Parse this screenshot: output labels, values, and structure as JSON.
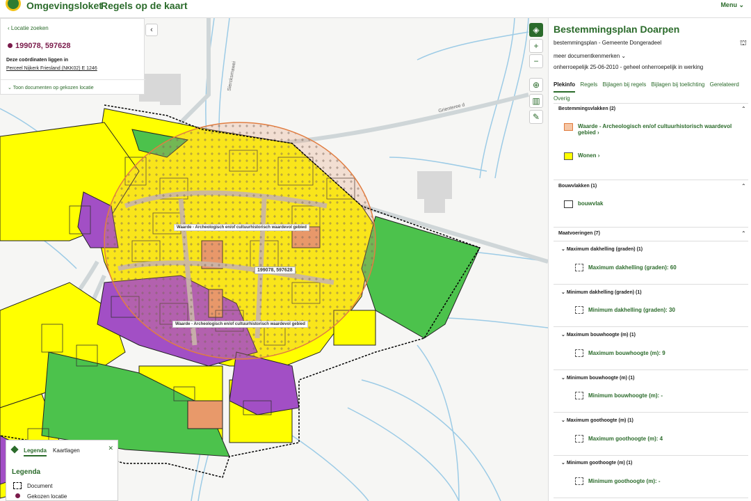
{
  "header": {
    "brand": "Omgevingsloket",
    "title": "Regels op de kaart",
    "menu_label": "Menu"
  },
  "location": {
    "back_label": "Locatie zoeken",
    "coordinates": "199078, 597628",
    "inside_label": "Deze coördinaten liggen in",
    "parcel": "Perceel Nijkerk Friesland (NKK02) E 1246",
    "show_docs_label": "Toon documenten op gekozen locatie"
  },
  "map": {
    "label_top": "Waarde - Archeologisch en/of cultuurhistorisch waardevol gebied",
    "label_bottom": "Waarde - Archeologisch en/of cultuurhistorisch waardevol gebied",
    "coord_label": "199078, 597628",
    "roads": [
      "Siercksmawei",
      "Grienteree d"
    ],
    "controls": [
      "layers",
      "zoom-in",
      "zoom-out",
      "locate",
      "measure",
      "draw"
    ]
  },
  "legend": {
    "tabs": [
      "Legenda",
      "Kaartlagen"
    ],
    "title": "Legenda",
    "items": [
      "Document",
      "Gekozen locatie"
    ]
  },
  "panel": {
    "title": "Bestemmingsplan Doarpen",
    "subtitle": "bestemmingsplan - Gemeente Dongeradeel",
    "more_label": "meer documentkenmerken",
    "status": "onherroepelijk 25-06-2010 - geheel onherroepelijk in werking",
    "tabs": [
      "Plekinfo",
      "Regels",
      "Bijlagen bij regels",
      "Bijlagen bij toelichting",
      "Gerelateerd",
      "Overig"
    ],
    "sections": {
      "bestemmingsvlakken": {
        "heading": "Bestemmingsvlakken (2)",
        "items": [
          {
            "label_line1": "Waarde - Archeologisch en/of cultuurhistorisch waardevol",
            "label_line2": "gebied",
            "color": "#f5c6a5",
            "border": "#e07a3c"
          },
          {
            "label_line1": "Wonen",
            "color": "#ffff00",
            "border": "#555555"
          }
        ]
      },
      "bouwvlakken": {
        "heading": "Bouwvlakken (1)",
        "items": [
          {
            "label": "bouwvlak"
          }
        ]
      },
      "maatvoeringen": {
        "heading": "Maatvoeringen (7)",
        "groups": [
          {
            "heading": "Maximum dakhelling (graden) (1)",
            "value": "Maximum dakhelling (graden): 60"
          },
          {
            "heading": "Minimum dakhelling (graden) (1)",
            "value": "Minimum dakhelling (graden): 30"
          },
          {
            "heading": "Maximum bouwhoogte (m) (1)",
            "value": "Maximum bouwhoogte (m): 9"
          },
          {
            "heading": "Minimum bouwhoogte (m) (1)",
            "value": "Minimum bouwhoogte (m): -"
          },
          {
            "heading": "Maximum goothoogte (m) (1)",
            "value": "Maximum goothoogte (m): 4"
          },
          {
            "heading": "Minimum goothoogte (m) (1)",
            "value": "Minimum goothoogte (m): -"
          }
        ]
      }
    }
  },
  "colors": {
    "brand_green": "#2b6b2b",
    "wonen_yellow": "#ffff00",
    "mixed_purple": "#a24fc5",
    "green_area": "#4cc24c",
    "archeo_orange": "#e07a3c",
    "pin_purple": "#7a1b4b"
  }
}
